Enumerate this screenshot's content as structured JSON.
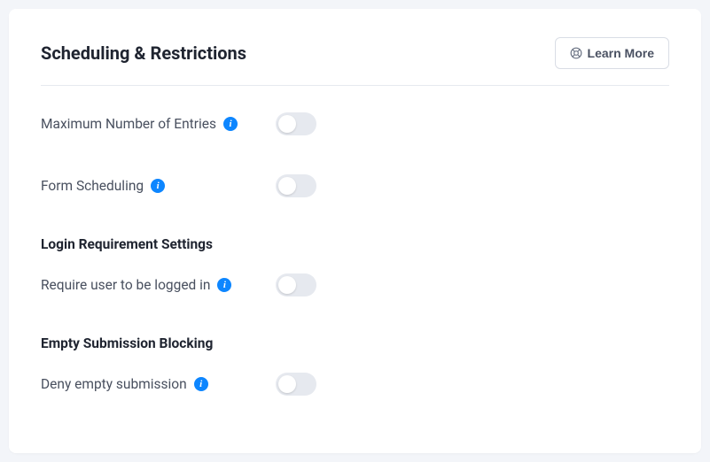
{
  "header": {
    "title": "Scheduling & Restrictions",
    "learnMoreLabel": "Learn More"
  },
  "rows": {
    "maxEntries": {
      "label": "Maximum Number of Entries",
      "toggled": false
    },
    "formScheduling": {
      "label": "Form Scheduling",
      "toggled": false
    },
    "requireLogin": {
      "label": "Require user to be logged in",
      "toggled": false
    },
    "denyEmpty": {
      "label": "Deny empty submission",
      "toggled": false
    }
  },
  "subheadings": {
    "loginRequirement": "Login Requirement Settings",
    "emptySubmission": "Empty Submission Blocking"
  },
  "icons": {
    "info": "i"
  }
}
